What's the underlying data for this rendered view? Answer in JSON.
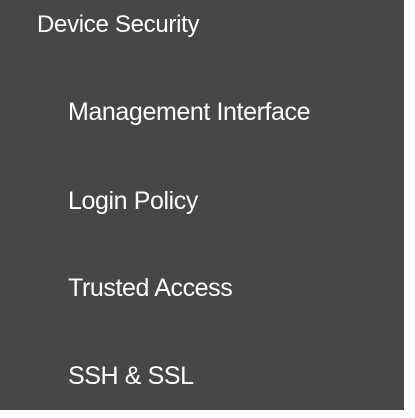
{
  "sidebar": {
    "section_title": "Device Security",
    "items": [
      {
        "label": "Management Interface"
      },
      {
        "label": "Login Policy"
      },
      {
        "label": "Trusted Access"
      },
      {
        "label": "SSH & SSL"
      }
    ]
  },
  "colors": {
    "panel_background": "#474747",
    "text": "#ffffff"
  }
}
